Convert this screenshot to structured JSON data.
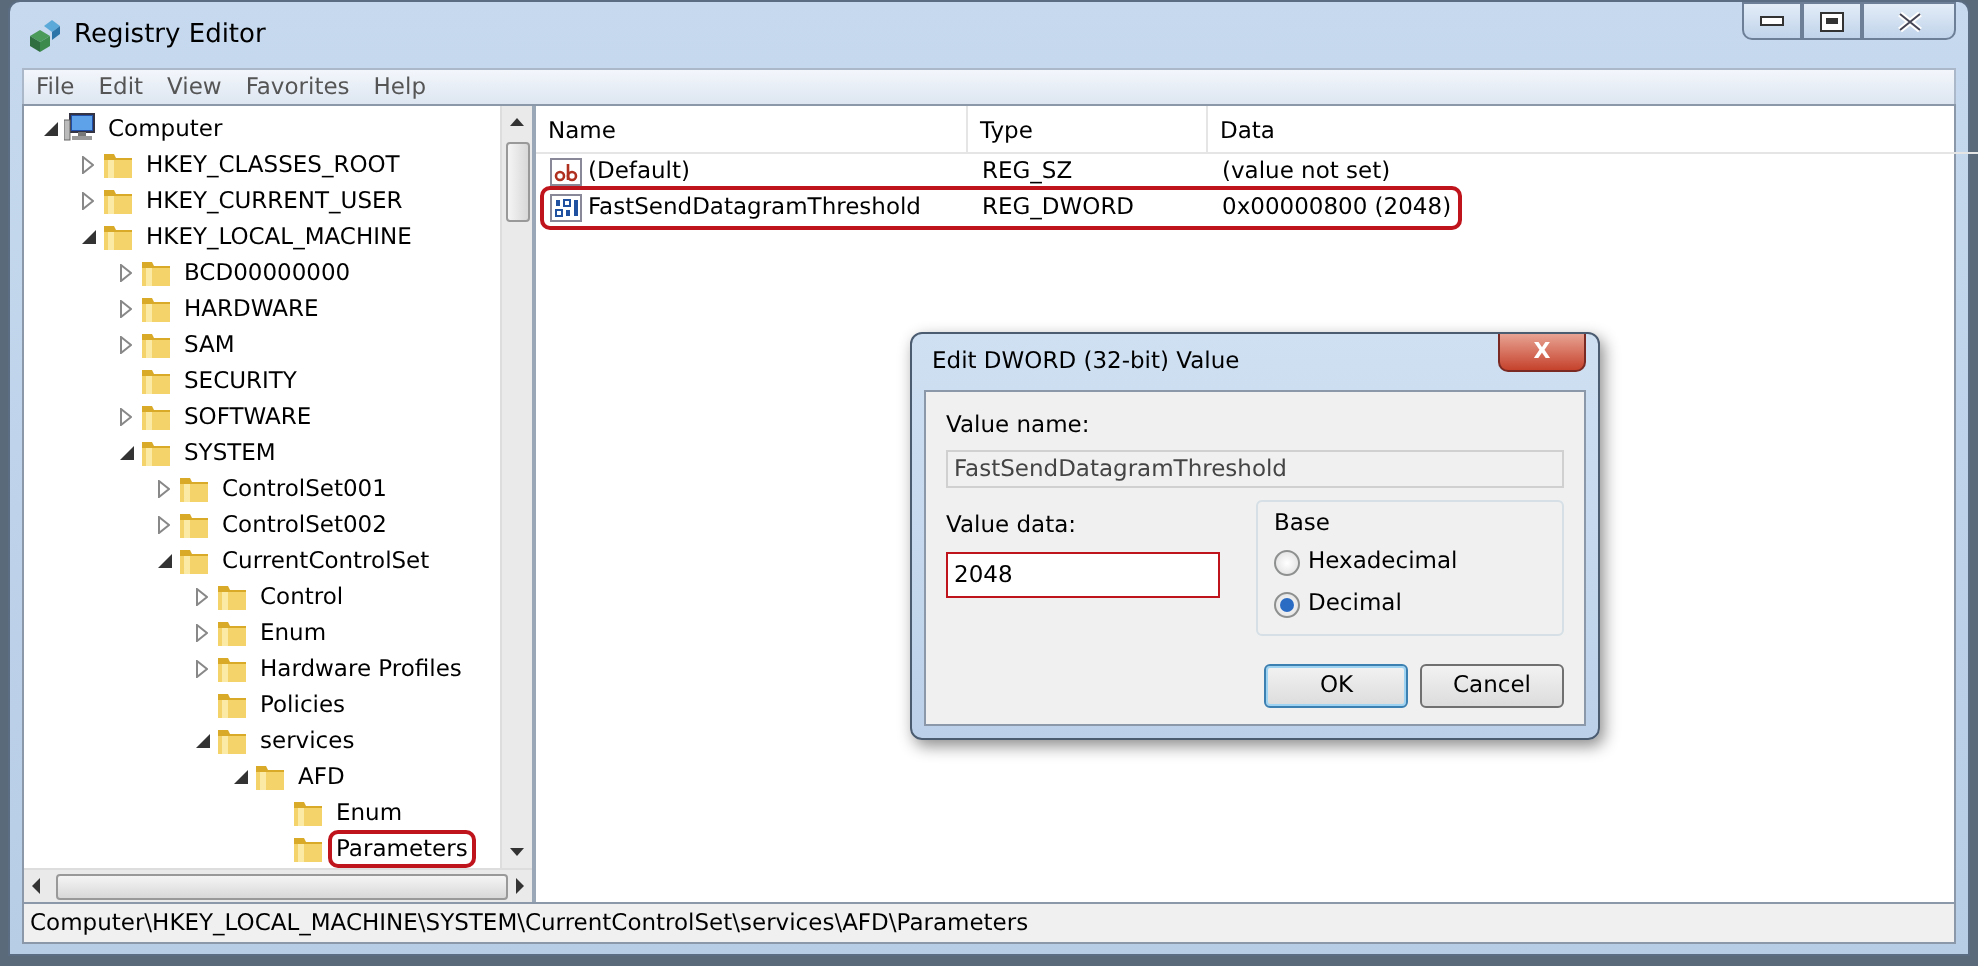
{
  "window": {
    "title": "Registry Editor"
  },
  "menu": [
    "File",
    "Edit",
    "View",
    "Favorites",
    "Help"
  ],
  "tree": [
    {
      "label": "Computer",
      "kind": "computer",
      "expanded": true,
      "highlighted": false,
      "children": [
        {
          "label": "HKEY_CLASSES_ROOT",
          "kind": "folder",
          "expanded": false,
          "highlighted": false
        },
        {
          "label": "HKEY_CURRENT_USER",
          "kind": "folder",
          "expanded": false,
          "highlighted": false
        },
        {
          "label": "HKEY_LOCAL_MACHINE",
          "kind": "folder",
          "expanded": true,
          "highlighted": false,
          "children": [
            {
              "label": "BCD00000000",
              "kind": "folder",
              "expanded": false,
              "highlighted": false
            },
            {
              "label": "HARDWARE",
              "kind": "folder",
              "expanded": false,
              "highlighted": false
            },
            {
              "label": "SAM",
              "kind": "folder",
              "expanded": false,
              "highlighted": false
            },
            {
              "label": "SECURITY",
              "kind": "leaf",
              "highlighted": false
            },
            {
              "label": "SOFTWARE",
              "kind": "folder",
              "expanded": false,
              "highlighted": false
            },
            {
              "label": "SYSTEM",
              "kind": "folder",
              "expanded": true,
              "highlighted": false,
              "children": [
                {
                  "label": "ControlSet001",
                  "kind": "folder",
                  "expanded": false,
                  "highlighted": false
                },
                {
                  "label": "ControlSet002",
                  "kind": "folder",
                  "expanded": false,
                  "highlighted": false
                },
                {
                  "label": "CurrentControlSet",
                  "kind": "folder",
                  "expanded": true,
                  "highlighted": false,
                  "children": [
                    {
                      "label": "Control",
                      "kind": "folder",
                      "expanded": false,
                      "highlighted": false
                    },
                    {
                      "label": "Enum",
                      "kind": "folder",
                      "expanded": false,
                      "highlighted": false
                    },
                    {
                      "label": "Hardware Profiles",
                      "kind": "folder",
                      "expanded": false,
                      "highlighted": false
                    },
                    {
                      "label": "Policies",
                      "kind": "leaf",
                      "highlighted": false
                    },
                    {
                      "label": "services",
                      "kind": "folder",
                      "expanded": true,
                      "highlighted": false,
                      "children": [
                        {
                          "label": "AFD",
                          "kind": "folder",
                          "expanded": true,
                          "highlighted": false,
                          "children": [
                            {
                              "label": "Enum",
                              "kind": "leaf",
                              "highlighted": false
                            },
                            {
                              "label": "Parameters",
                              "kind": "leaf",
                              "highlighted": true
                            }
                          ]
                        }
                      ]
                    }
                  ]
                }
              ]
            }
          ]
        }
      ]
    }
  ],
  "values": {
    "columns": [
      "Name",
      "Type",
      "Data"
    ],
    "rows": [
      {
        "kind": "string",
        "name": "(Default)",
        "type": "REG_SZ",
        "data": "(value not set)",
        "highlighted": false
      },
      {
        "kind": "dword",
        "name": "FastSendDatagramThreshold",
        "type": "REG_DWORD",
        "data": "0x00000800 (2048)",
        "highlighted": true
      }
    ]
  },
  "dialog": {
    "title": "Edit DWORD (32-bit) Value",
    "close": "X",
    "value_name_label": "Value name:",
    "value_name": "FastSendDatagramThreshold",
    "value_data_label": "Value data:",
    "value_data": "2048",
    "value_data_highlighted": true,
    "base_label": "Base",
    "bases": [
      {
        "label": "Hexadecimal",
        "selected": false
      },
      {
        "label": "Decimal",
        "selected": true
      }
    ],
    "buttons": [
      {
        "label": "OK",
        "default": true
      },
      {
        "label": "Cancel",
        "default": false
      }
    ]
  },
  "status_bar": "Computer\\HKEY_LOCAL_MACHINE\\SYSTEM\\CurrentControlSet\\services\\AFD\\Parameters"
}
